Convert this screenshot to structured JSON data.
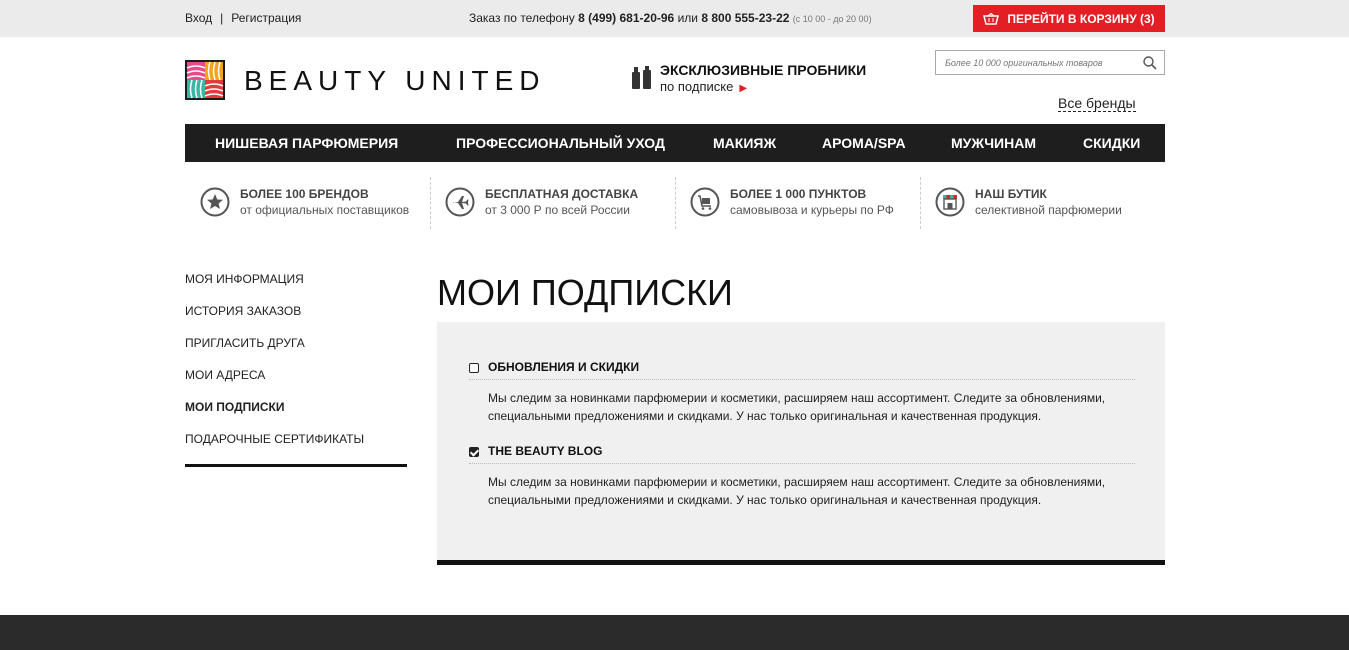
{
  "topbar": {
    "login": "Вход",
    "separator": "|",
    "register": "Регистрация",
    "phone_prefix": "Заказ по телефону",
    "phone1": "8 (499) 681-20-96",
    "phone_or": "или",
    "phone2": "8 800 555-23-22",
    "hours": "(с 10 00 - до 20 00)",
    "cart_label": "ПЕРЕЙТИ В КОРЗИНУ (3)",
    "cart_count": 3
  },
  "header": {
    "brand": "BEAUTY UNITED",
    "promo_title": "ЭКСКЛЮЗИВНЫЕ ПРОБНИКИ",
    "promo_sub": "по подписке",
    "search_placeholder": "Более 10 000 оригинальных товаров",
    "all_brands": "Все бренды"
  },
  "nav": {
    "items": [
      {
        "label": "НИШЕВАЯ ПАРФЮМЕРИЯ"
      },
      {
        "label": "ПРОФЕССИОНАЛЬНЫЙ УХОД"
      },
      {
        "label": "МАКИЯЖ"
      },
      {
        "label": "АРОМА/SPA"
      },
      {
        "label": "МУЖЧИНАМ"
      },
      {
        "label": "СКИДКИ"
      }
    ]
  },
  "features": [
    {
      "title": "БОЛЕЕ 100 БРЕНДОВ",
      "sub": "от официальных поставщиков",
      "icon": "star-icon"
    },
    {
      "title": "БЕСПЛАТНАЯ ДОСТАВКА",
      "sub": "от 3 000 Р по всей России",
      "icon": "plane-icon"
    },
    {
      "title": "БОЛЕЕ 1 000 ПУНКТОВ",
      "sub": "самовывоза и курьеры по РФ",
      "icon": "cart-icon"
    },
    {
      "title": "НАШ БУТИК",
      "sub": "селективной парфюмерии",
      "icon": "shop-icon"
    }
  ],
  "sidebar": {
    "items": [
      {
        "label": "МОЯ ИНФОРМАЦИЯ",
        "active": false
      },
      {
        "label": "ИСТОРИЯ ЗАКАЗОВ",
        "active": false
      },
      {
        "label": "ПРИГЛАСИТЬ ДРУГА",
        "active": false
      },
      {
        "label": "МОИ АДРЕСА",
        "active": false
      },
      {
        "label": "МОИ ПОДПИСКИ",
        "active": true
      },
      {
        "label": "ПОДАРОЧНЫЕ СЕРТИФИКАТЫ",
        "active": false
      }
    ]
  },
  "main": {
    "title": "МОИ ПОДПИСКИ",
    "subscriptions": [
      {
        "label": "ОБНОВЛЕНИЯ И СКИДКИ",
        "checked": false,
        "description": "Мы следим за новинками парфюмерии и косметики, расширяем наш ассортимент. Следите за обновлениями, специальными предложениями и скидками. У нас только оригинальная и качественная продукция."
      },
      {
        "label": "THE BEAUTY BLOG",
        "checked": true,
        "description": "Мы следим за новинками парфюмерии и косметики, расширяем наш ассортимент. Следите за обновлениями, специальными предложениями и скидками. У нас только оригинальная и качественная продукция."
      }
    ]
  },
  "colors": {
    "accent": "#e31e24",
    "nav_bg": "#1e1e1e",
    "topbar_bg": "#ebebeb",
    "panel_bg": "#f0f0f0",
    "footer_bg": "#2b2b2b"
  }
}
